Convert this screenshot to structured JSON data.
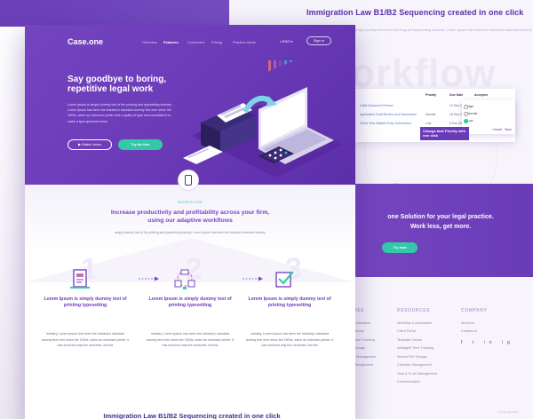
{
  "bg": {
    "title": "Immigration Law B1/B2 Sequencing created in one click",
    "subtitle": "Lorem Ipsum is simply dummy text of the printing and typesetting industry. Lorem Ipsum has been the industry's standard dummy",
    "workflow_word": "orkflow",
    "table": {
      "headers": [
        "Priority",
        "Due Date",
        "Acceptor"
      ],
      "rows": [
        [
          "Initial Document Review",
          "",
          "12 Dec 2016",
          "Pending"
        ],
        [
          "Application Draft Review and Submission",
          "Normal",
          "18 Dec 2016",
          "Pending"
        ],
        [
          "Client Time Billable Entry Submission",
          "Low",
          "8 Dec 2016",
          "Pending"
        ]
      ]
    },
    "dropdown": {
      "options": [
        "High",
        "Normal",
        "Low"
      ],
      "selected": "Low",
      "cancel": "Cancel",
      "save": "Save"
    },
    "callout": "Change task Priority with one click",
    "cta_line1": "one Solution for your legal practice.",
    "cta_line2": "Work less, get more.",
    "try_now": "Try now",
    "footer": {
      "col1": {
        "heading": "RES",
        "items": [
          "Automation",
          "Library",
          "Time Tracking",
          "Storage",
          "e Management",
          "Management"
        ]
      },
      "resources": {
        "heading": "RESOURCES",
        "items": [
          "Workflow & Automation",
          "Client Portal",
          "Template Library",
          "Intelligent Time Tracking",
          "Secure File Storage",
          "Calendar Management",
          "Task & To-do Management",
          "Communication"
        ]
      },
      "company": {
        "heading": "COMPANY",
        "items": [
          "About us",
          "Contact us"
        ]
      },
      "social": [
        "f",
        "t",
        "in",
        "ig"
      ],
      "copyright": "© Copyright 2016"
    }
  },
  "nav": {
    "logo": "Case.one",
    "links": [
      "Overview",
      "Features",
      "Customers",
      "Pricing",
      "Practice areas"
    ],
    "active": "Features",
    "lang": "ENG",
    "signin": "Sign in"
  },
  "hero": {
    "title": "Say goodbye to boring, repetitive legal work",
    "body": "Lorem Ipsum is simply dummy text of the printing and typesetting industry. Lorem Ipsum has been the industry's standard dummy text ever since the 1500s, when an unknown printer took a galley of type and scrambled it to make a type specimen book.",
    "watch_video": "Watch video",
    "try_free": "Try for free"
  },
  "workflow": {
    "label": "WORKFLOW",
    "title": "Increase productivity and profitability across your firm, using our adaptive workflows",
    "subtitle": "simply dummy text of the printing and typesetting industry. Lorem Ipsum has been the industry's standard dummy",
    "steps": [
      {
        "num": "1",
        "title": "Lorem Ipsum is simply dummy text of printing typesetting",
        "body": "industry. Lorem Ipsum has been the industry's standard dummy text ever since the 1500s, when an unknown printer. It has survived only five centuries, but the"
      },
      {
        "num": "2",
        "title": "Lorem Ipsum is simply dummy text of printing typesetting",
        "body": "industry. Lorem Ipsum has been the industry's standard dummy text ever since the 1500s, when an unknown printer. It has survived only five centuries, but the"
      },
      {
        "num": "3",
        "title": "Lorem Ipsum is simply dummy text of printing typesetting",
        "body": "industry. Lorem Ipsum has been the industry's standard dummy text ever since the 1500s, when an unknown printer. It has survived only five centuries, but the"
      }
    ]
  },
  "bottom_title": "Immigration Law B1/B2 Sequencing created in one click",
  "colors": {
    "purple": "#6b3bb8",
    "green": "#33c9a8",
    "heading": "#7646c2"
  }
}
